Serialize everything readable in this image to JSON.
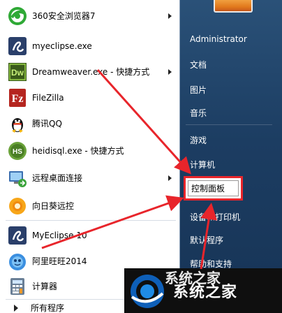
{
  "programs": [
    {
      "label": "360安全浏览器7",
      "icon": "360-browser-icon",
      "has_submenu": true
    },
    {
      "label": "myeclipse.exe",
      "icon": "myeclipse-icon",
      "has_submenu": false
    },
    {
      "label": "Dreamweaver.exe - 快捷方式",
      "icon": "dreamweaver-icon",
      "has_submenu": true
    },
    {
      "label": "FileZilla",
      "icon": "filezilla-icon",
      "has_submenu": false
    },
    {
      "label": "腾讯QQ",
      "icon": "qq-penguin-icon",
      "has_submenu": false
    },
    {
      "label": "heidisql.exe - 快捷方式",
      "icon": "heidisql-icon",
      "has_submenu": false
    },
    {
      "label": "远程桌面连接",
      "icon": "remote-desktop-icon",
      "has_submenu": true
    },
    {
      "label": "向日葵远控",
      "icon": "sunflower-icon",
      "has_submenu": false
    },
    {
      "label": "MyEclipse 10",
      "icon": "myeclipse-icon",
      "has_submenu": false
    },
    {
      "label": "阿里旺旺2014",
      "icon": "aliwangwang-icon",
      "has_submenu": false
    },
    {
      "label": "计算器",
      "icon": "calculator-icon",
      "has_submenu": false
    }
  ],
  "all_programs_label": "所有程序",
  "right_menu": {
    "user": "Administrator",
    "items": [
      "文档",
      "图片",
      "音乐",
      "游戏",
      "计算机",
      "控制面板",
      "设备和打印机",
      "默认程序",
      "帮助和支持"
    ]
  },
  "watermark": {
    "title": "系统之家",
    "ghost": "系统之家"
  },
  "colors": {
    "highlight_border": "#e8252b",
    "arrow": "#e8252b",
    "right_pane": "#1c3d62"
  }
}
